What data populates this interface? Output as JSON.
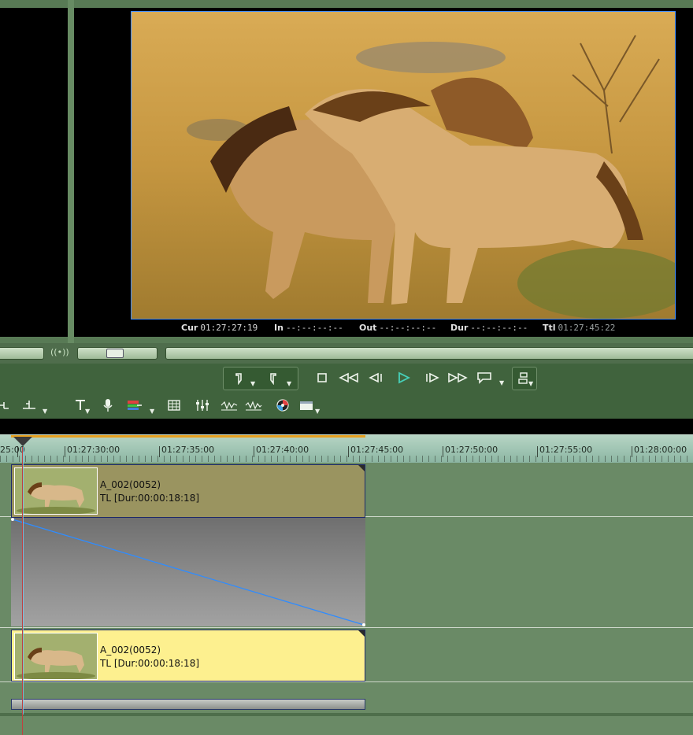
{
  "monitor": {
    "timecodes": {
      "cur_label": "Cur",
      "cur_value": "01:27:27:19",
      "in_label": "In",
      "in_value": "--:--:--:--",
      "out_label": "Out",
      "out_value": "--:--:--:--",
      "dur_label": "Dur",
      "dur_value": "--:--:--:--",
      "ttl_label": "Ttl",
      "ttl_value": "01:27:45:22"
    }
  },
  "timeline": {
    "ruler_labels": [
      "25:00",
      "01:27:30:00",
      "01:27:35:00",
      "01:27:40:00",
      "01:27:45:00",
      "01:27:50:00",
      "01:27:55:00",
      "01:28:00:00"
    ],
    "clips": [
      {
        "name": "A_002(0052)",
        "duration": "TL [Dur:00:00:18:18]"
      },
      {
        "name": "A_002(0052)",
        "duration": "TL [Dur:00:00:18:18]"
      }
    ]
  },
  "colors": {
    "panel_bg": "#587a55",
    "video_clip": "#9a9460",
    "audio_clip": "#fdf08f",
    "rubber_band": "#2f8cff",
    "play_icon": "#46d0b8"
  },
  "icons": {
    "mark_in": "mark-in-icon",
    "mark_out": "mark-out-icon",
    "stop": "stop-icon",
    "rewind": "rewind-icon",
    "step_back": "step-back-icon",
    "play": "play-icon",
    "step_forward": "step-forward-icon",
    "fast_forward": "fast-forward-icon",
    "loop": "loop-icon",
    "options": "options-icon"
  }
}
